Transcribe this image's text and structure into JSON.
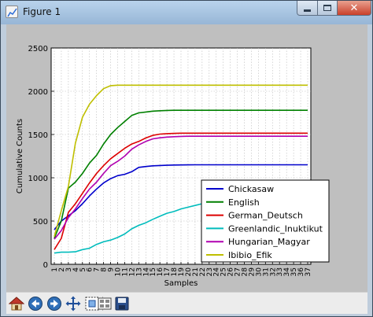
{
  "window": {
    "title": "Figure 1"
  },
  "toolbar": {
    "buttons": [
      {
        "name": "home-button",
        "icon": "home-icon"
      },
      {
        "name": "back-button",
        "icon": "back-arrow-icon"
      },
      {
        "name": "forward-button",
        "icon": "forward-arrow-icon"
      },
      {
        "name": "pan-button",
        "icon": "pan-arrows-icon"
      },
      {
        "name": "zoom-button",
        "icon": "zoom-rect-icon"
      },
      {
        "name": "configure-subplots-button",
        "icon": "configure-subplots-icon"
      },
      {
        "name": "save-button",
        "icon": "floppy-save-icon"
      }
    ]
  },
  "chart_data": {
    "type": "line",
    "xlabel": "Samples",
    "ylabel": "Cumulative Counts",
    "categories": [
      "1",
      "2",
      "3",
      "4",
      "5",
      "6",
      "7",
      "8",
      "9",
      "10",
      "11",
      "12",
      "13",
      "14",
      "15",
      "16",
      "17",
      "18",
      "19",
      "20",
      "21",
      "22",
      "23",
      "24",
      "25",
      "26",
      "27",
      "28",
      "29",
      "30",
      "31",
      "32",
      "33",
      "34",
      "35",
      "36",
      "37"
    ],
    "ylim": [
      0,
      2500
    ],
    "yticks": [
      0,
      500,
      1000,
      1500,
      2000,
      2500
    ],
    "grid": true,
    "legend_position": "lower-right",
    "series": [
      {
        "name": "Chickasaw",
        "color": "#0000cc",
        "values": [
          400,
          500,
          560,
          620,
          700,
          790,
          870,
          940,
          990,
          1025,
          1040,
          1070,
          1120,
          1130,
          1138,
          1142,
          1145,
          1147,
          1148,
          1149,
          1150,
          1150,
          1150,
          1150,
          1150,
          1150,
          1150,
          1150,
          1150,
          1150,
          1150,
          1150,
          1150,
          1150,
          1150,
          1150,
          1150
        ]
      },
      {
        "name": "English",
        "color": "#008000",
        "values": [
          300,
          500,
          880,
          950,
          1050,
          1170,
          1260,
          1390,
          1500,
          1580,
          1650,
          1720,
          1750,
          1760,
          1770,
          1775,
          1778,
          1780,
          1780,
          1780,
          1780,
          1780,
          1780,
          1780,
          1780,
          1780,
          1780,
          1780,
          1780,
          1780,
          1780,
          1780,
          1780,
          1780,
          1780,
          1780,
          1780
        ]
      },
      {
        "name": "German_Deutsch",
        "color": "#dd0000",
        "values": [
          170,
          300,
          600,
          700,
          820,
          940,
          1050,
          1140,
          1220,
          1280,
          1340,
          1390,
          1420,
          1460,
          1490,
          1505,
          1510,
          1513,
          1515,
          1515,
          1515,
          1515,
          1515,
          1515,
          1515,
          1515,
          1515,
          1515,
          1515,
          1515,
          1515,
          1515,
          1515,
          1515,
          1515,
          1515,
          1515
        ]
      },
      {
        "name": "Greenlandic_Inuktikut",
        "color": "#00bcbc",
        "values": [
          130,
          140,
          140,
          145,
          170,
          185,
          230,
          260,
          280,
          310,
          350,
          410,
          450,
          480,
          520,
          555,
          590,
          610,
          640,
          660,
          680,
          700,
          720,
          740,
          760,
          780,
          800,
          820,
          830,
          850,
          865,
          880,
          890,
          900,
          910,
          915,
          920
        ]
      },
      {
        "name": "Hungarian_Magyar",
        "color": "#b000b0",
        "values": [
          290,
          390,
          540,
          640,
          760,
          870,
          950,
          1050,
          1140,
          1190,
          1250,
          1330,
          1380,
          1420,
          1450,
          1462,
          1470,
          1475,
          1478,
          1480,
          1480,
          1480,
          1480,
          1480,
          1480,
          1480,
          1480,
          1480,
          1480,
          1480,
          1480,
          1480,
          1480,
          1480,
          1480,
          1480,
          1480
        ]
      },
      {
        "name": "Ibibio_Efik",
        "color": "#bfbf00",
        "values": [
          320,
          620,
          900,
          1400,
          1700,
          1850,
          1950,
          2030,
          2065,
          2070,
          2070,
          2070,
          2070,
          2070,
          2070,
          2070,
          2070,
          2070,
          2070,
          2070,
          2070,
          2070,
          2070,
          2070,
          2070,
          2070,
          2070,
          2070,
          2070,
          2070,
          2070,
          2070,
          2070,
          2070,
          2070,
          2070,
          2070
        ]
      }
    ]
  }
}
